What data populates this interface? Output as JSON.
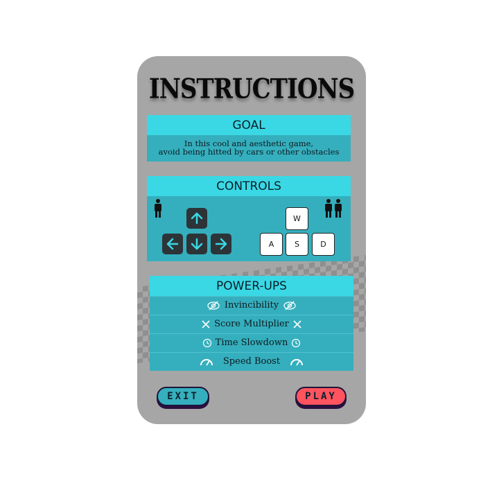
{
  "title": "INSTRUCTIONS",
  "goal": {
    "heading": "GOAL",
    "line1": "In this cool and aesthetic game,",
    "line2": "avoid being hitted by cars or other obstacles"
  },
  "controls": {
    "heading": "CONTROLS",
    "player1_icon": "person-icon",
    "player2_icon": "two-people-icon",
    "arrow_keys": [
      "up",
      "left",
      "down",
      "right"
    ],
    "letter_keys": [
      "W",
      "A",
      "S",
      "D"
    ]
  },
  "powerups": {
    "heading": "POWER-UPS",
    "items": [
      {
        "label": "Invincibility",
        "icon": "eye-slash-icon"
      },
      {
        "label": "Score Multiplier",
        "icon": "x-icon"
      },
      {
        "label": "Time Slowdown",
        "icon": "clock-icon"
      },
      {
        "label": "Speed Boost",
        "icon": "speedometer-icon"
      }
    ]
  },
  "buttons": {
    "exit": "EXIT",
    "play": "PLAY"
  },
  "colors": {
    "card": "#a6a6a6",
    "panel_head": "#3ad8e4",
    "panel_body": "#35afbd",
    "exit": "#35afbd",
    "play": "#ff5460",
    "key": "#2c3438"
  }
}
